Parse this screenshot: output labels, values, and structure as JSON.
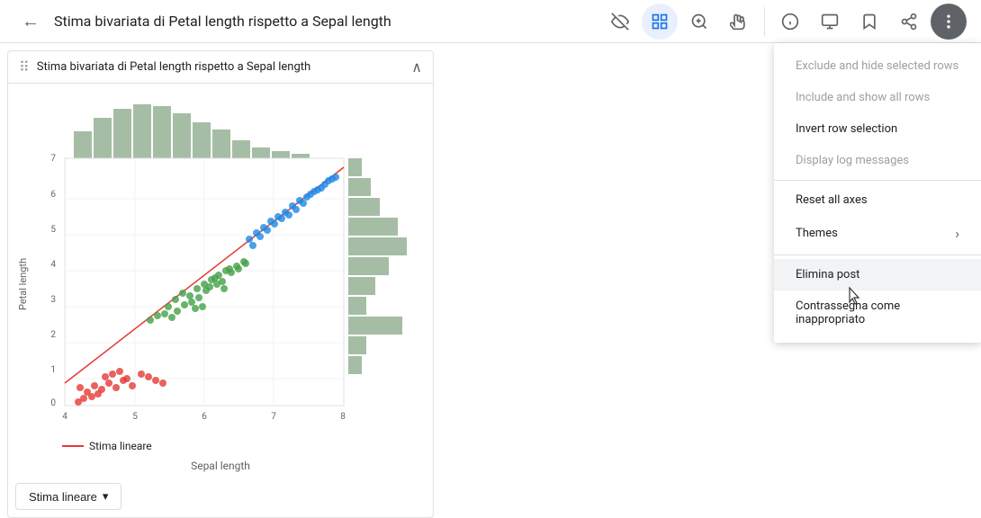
{
  "toolbar": {
    "back_icon": "←",
    "title": "Stima bivariata di Petal length rispetto a Sepal length",
    "icons": [
      {
        "name": "visibility-off-icon",
        "symbol": "⊘",
        "active": false
      },
      {
        "name": "select-icon",
        "symbol": "▦",
        "active": true
      },
      {
        "name": "search-icon",
        "symbol": "🔍",
        "active": false
      },
      {
        "name": "pan-icon",
        "symbol": "✋",
        "active": false
      },
      {
        "name": "info-icon",
        "symbol": "ℹ",
        "active": false
      },
      {
        "name": "monitor-icon",
        "symbol": "🖥",
        "active": false
      },
      {
        "name": "bookmark-icon",
        "symbol": "🔖",
        "active": false
      },
      {
        "name": "share-icon",
        "symbol": "↗",
        "active": false
      },
      {
        "name": "more-icon",
        "symbol": "⋮",
        "active": false
      }
    ]
  },
  "chart_card": {
    "title": "Stima bivariata di Petal length rispetto a Sepal length",
    "drag_icon": "⠿",
    "expand_icon": "∧",
    "x_label": "Sepal length",
    "y_label": "Petal length",
    "legend_label": "Stima lineare",
    "button_label": "Stima lineare",
    "button_dropdown": "▾"
  },
  "menu": {
    "items": [
      {
        "label": "Exclude and hide selected rows",
        "disabled": true,
        "has_arrow": false
      },
      {
        "label": "Include and show all rows",
        "disabled": true,
        "has_arrow": false
      },
      {
        "label": "Invert row selection",
        "disabled": false,
        "has_arrow": false
      },
      {
        "label": "Display log messages",
        "disabled": true,
        "has_arrow": false
      },
      {
        "label": "Reset all axes",
        "disabled": false,
        "has_arrow": false
      },
      {
        "label": "Themes",
        "disabled": false,
        "has_arrow": true
      },
      {
        "label": "Elimina post",
        "disabled": false,
        "has_arrow": false,
        "highlighted": true
      },
      {
        "label": "Contrassegna come inappropriato",
        "disabled": false,
        "has_arrow": false
      }
    ]
  }
}
